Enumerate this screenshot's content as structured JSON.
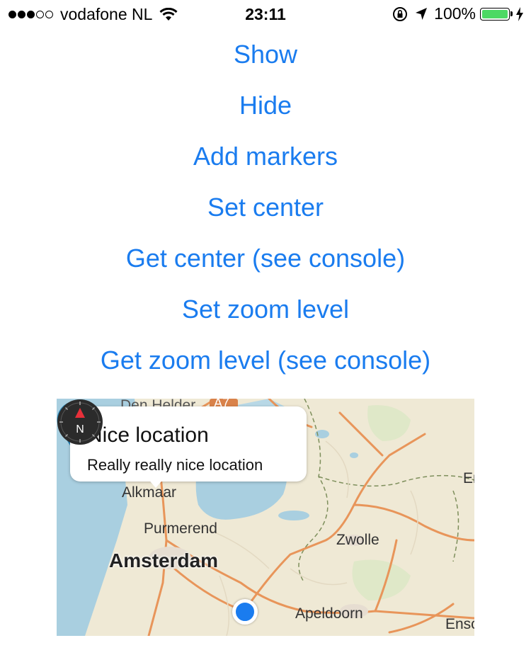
{
  "status_bar": {
    "carrier": "vodafone NL",
    "signal_full_dots": 3,
    "signal_empty_dots": 2,
    "time": "23:11",
    "battery_percent": "100%",
    "battery_level": 1.0,
    "icons": [
      "wifi-icon",
      "orientation-lock-icon",
      "location-arrow-icon",
      "battery-icon",
      "charging-icon"
    ]
  },
  "buttons": {
    "show": "Show",
    "hide": "Hide",
    "add_markers": "Add markers",
    "set_center": "Set center",
    "get_center": "Get center (see console)",
    "set_zoom": "Set zoom level",
    "get_zoom": "Get zoom level (see console)"
  },
  "map": {
    "callout": {
      "title": "Nice location",
      "subtitle": "Really really nice location"
    },
    "labels": {
      "den_helder": "Den Helder",
      "road_badge": "A7",
      "alkmaar": "Alkmaar",
      "purmerend": "Purmerend",
      "amsterdam": "Amsterdam",
      "zwolle": "Zwolle",
      "apeldoorn": "Apeldoorn",
      "enschede": "Ensc",
      "emmen": "Er"
    },
    "compass_label": "N",
    "colors": {
      "accent": "#1a7cef",
      "land": "#efe9d5",
      "water": "#a9cfe0",
      "road": "#e8955a",
      "pin": "#2b91c6",
      "compass_needle": "#e8303a"
    }
  }
}
